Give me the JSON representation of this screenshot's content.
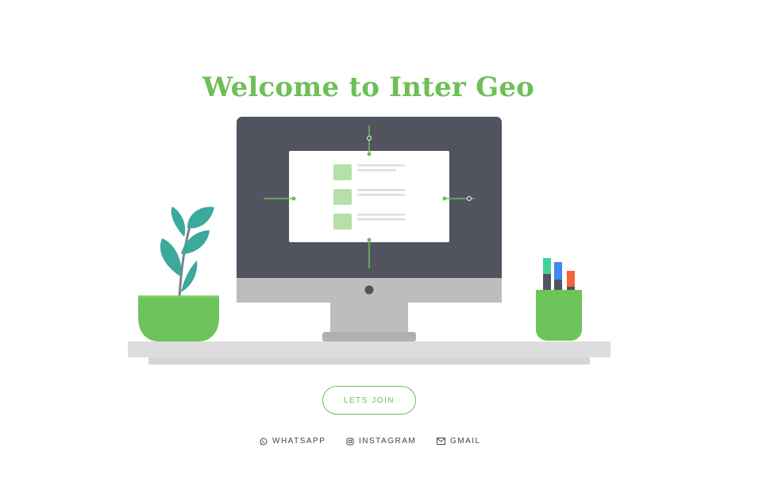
{
  "hero": {
    "title": "Welcome to Inter Geo"
  },
  "cta": {
    "join_label": "LETS JOIN"
  },
  "socials": [
    {
      "label": "WHATSAPP",
      "icon": "whatsapp-icon"
    },
    {
      "label": "INSTAGRAM",
      "icon": "instagram-icon"
    },
    {
      "label": "GMAIL",
      "icon": "mail-icon"
    }
  ],
  "colors": {
    "accent": "#6dbf56",
    "screen": "#51535f",
    "desk": "#dddddd"
  }
}
